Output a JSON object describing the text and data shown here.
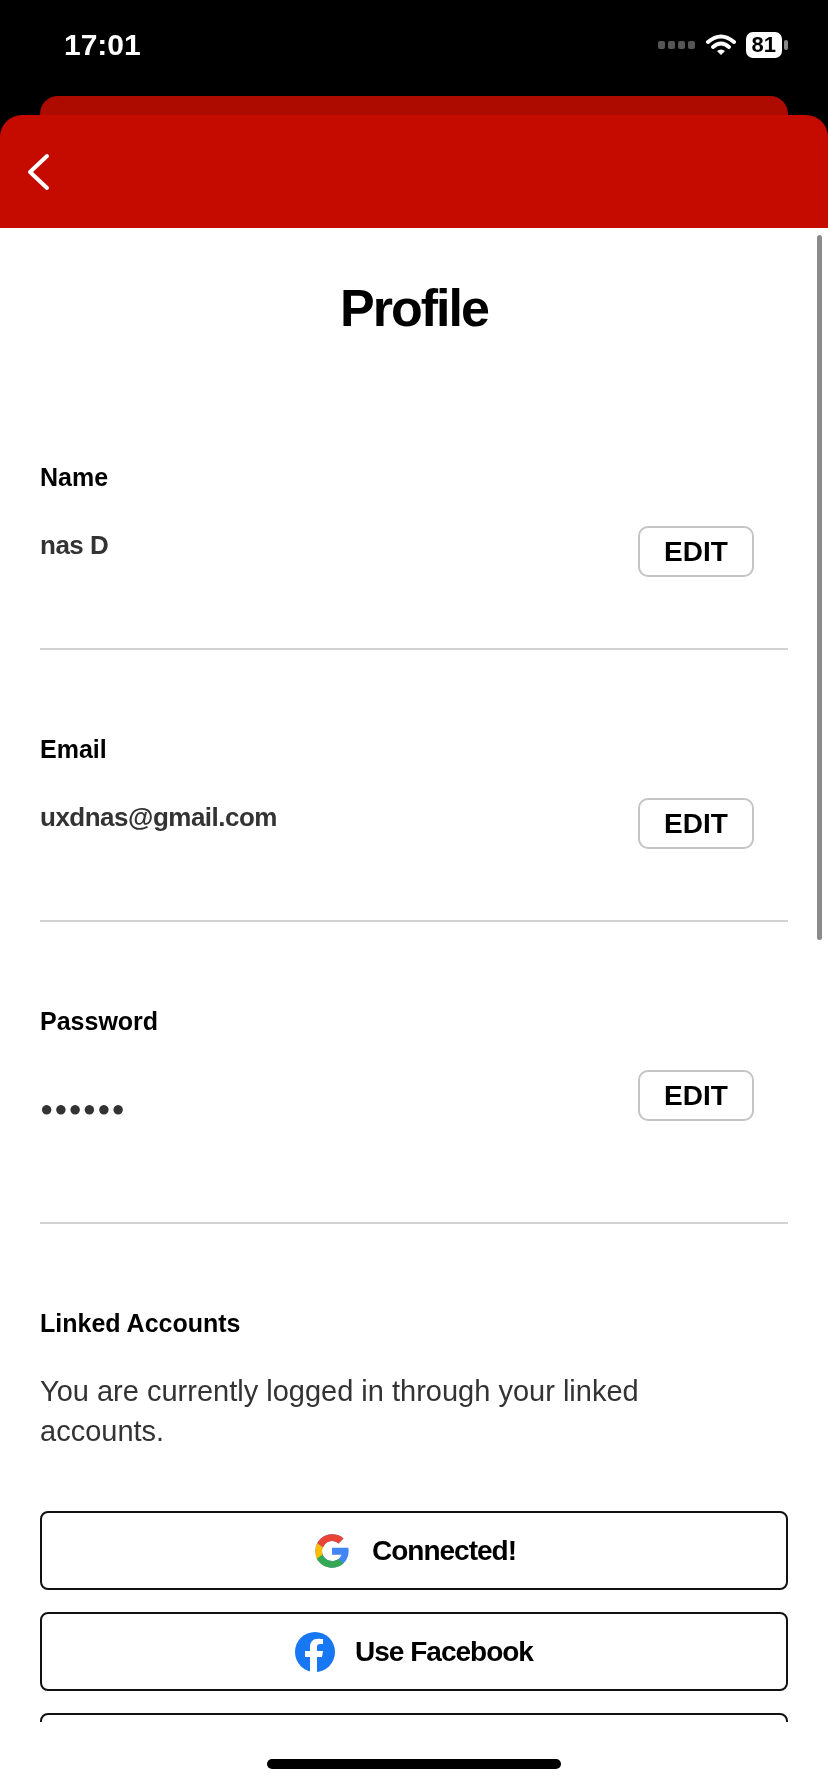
{
  "status_bar": {
    "time": "17:01",
    "battery": "81"
  },
  "title": "Profile",
  "fields": [
    {
      "label": "Name",
      "value": "nas D",
      "kind": "text",
      "button": "EDIT"
    },
    {
      "label": "Email",
      "value": "uxdnas@gmail.com",
      "kind": "text",
      "button": "EDIT"
    },
    {
      "label": "Password",
      "value": "●●●●●●",
      "kind": "password",
      "button": "EDIT"
    }
  ],
  "linked_accounts": {
    "heading": "Linked Accounts",
    "description": "You are currently logged in through your linked accounts.",
    "buttons": [
      {
        "label": "Connected!",
        "kind": "google"
      },
      {
        "label": "Use Facebook",
        "kind": "facebook"
      }
    ]
  }
}
